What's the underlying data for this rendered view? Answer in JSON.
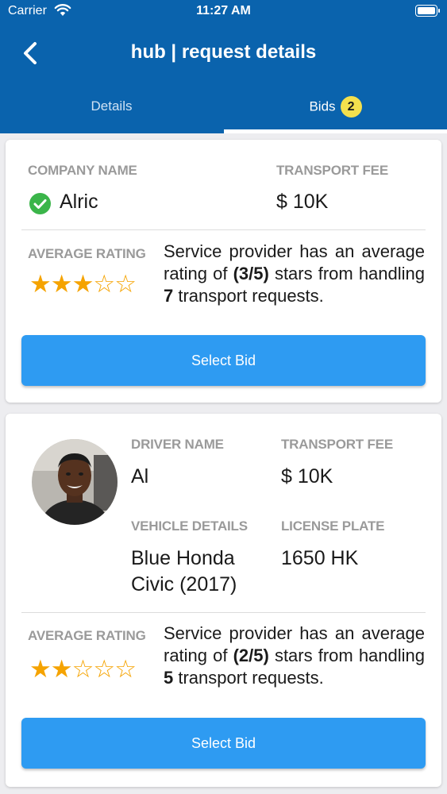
{
  "status_bar": {
    "carrier": "Carrier",
    "time": "11:27 AM"
  },
  "header": {
    "title": "hub | request details"
  },
  "tabs": {
    "details": "Details",
    "bids": "Bids",
    "bids_badge": "2"
  },
  "colors": {
    "header": "#0a63ad",
    "button": "#2e9bf2",
    "star": "#f5a300",
    "check": "#3bb54a",
    "badge": "#f4e04d"
  },
  "bid1": {
    "company_label": "COMPANY NAME",
    "company_value": "Alric",
    "fee_label": "TRANSPORT FEE",
    "fee_value": "$ 10K",
    "rating_label": "AVERAGE RATING",
    "rating": 3,
    "rating_max": 5,
    "desc_pre": "Service provider has an average rating of ",
    "desc_score": "(3/5)",
    "desc_mid": " stars from handling ",
    "desc_count": "7",
    "desc_post": " transport requests.",
    "button": "Select Bid"
  },
  "bid2": {
    "driver_label": "DRIVER NAME",
    "driver_value": "Al",
    "fee_label": "TRANSPORT FEE",
    "fee_value": "$ 10K",
    "vehicle_label": "VEHICLE DETAILS",
    "vehicle_line1": "Blue Honda",
    "vehicle_line2": "Civic (2017)",
    "plate_label": "LICENSE PLATE",
    "plate_value": "1650 HK",
    "rating_label": "AVERAGE RATING",
    "rating": 2,
    "rating_max": 5,
    "desc_pre": "Service provider has an average rating of ",
    "desc_score": "(2/5)",
    "desc_mid": " stars from handling ",
    "desc_count": "5",
    "desc_post": " transport requests.",
    "button": "Select Bid"
  }
}
